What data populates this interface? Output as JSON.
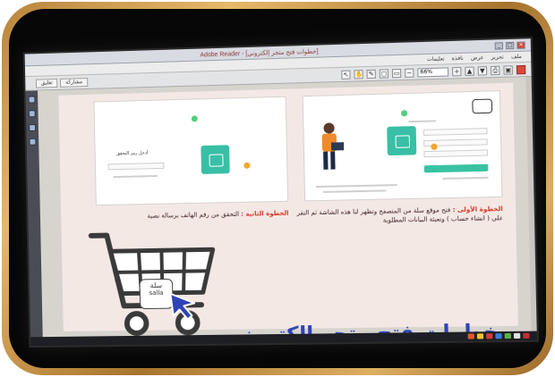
{
  "window": {
    "title": "Adobe Reader - [خطوات فتح متجر إلكتروني]",
    "controls": [
      "_",
      "□",
      "×"
    ]
  },
  "menubar": {
    "items": [
      "ملف",
      "تحرير",
      "عرض",
      "نافذة",
      "تعليمات"
    ]
  },
  "toolbar": {
    "tabs": [
      "تعليق",
      "مشاركة"
    ],
    "zoom": "66%"
  },
  "slide": {
    "step1": {
      "label": "الخطوة الأولى :",
      "line1": "فتح موقع سلة من المتصفح وتظهر لنا هذه الشاشة ثم النقر",
      "line2": "على ( انشاء حساب ) وتعبئة البيانات المطلوبة"
    },
    "step2": {
      "label": "الخطوة الثانية :",
      "line1": "التحقق من رقم الهاتف برسالة نصية"
    },
    "shot2_text": "أدخل رمز التحقق",
    "headline": "خطوات فتح متجر إلكتروني",
    "badge": {
      "ar": "سلة",
      "en": "salla"
    }
  },
  "colors": {
    "headline": "#2d43b8",
    "step_label": "#d23a2a",
    "teal": "#38c2a4",
    "frame": "#c8944a"
  }
}
